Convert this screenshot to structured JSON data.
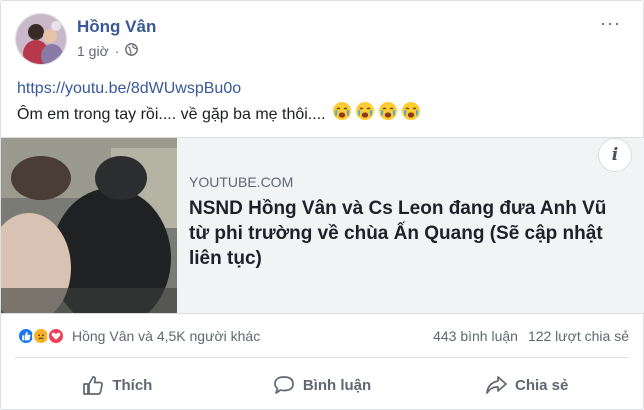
{
  "post": {
    "author": "Hồng Vân",
    "timestamp": "1 giờ",
    "privacy_icon": "globe-icon",
    "more_label": "···"
  },
  "content": {
    "link": "https://youtu.be/8dWUwspBu0o",
    "message": "Ôm em trong tay rồi.... về gặp ba mẹ thôi....",
    "emojis": [
      "crying-face",
      "crying-face",
      "crying-face",
      "crying-face"
    ]
  },
  "link_preview": {
    "domain": "YOUTUBE.COM",
    "title": "NSND Hồng Vân và Cs Leon đang đưa Anh Vũ từ phi trường về chùa Ấn Quang (Sẽ cập nhật liên tục)",
    "info_label": "i"
  },
  "stats": {
    "reaction_icons": [
      "like",
      "sad",
      "love"
    ],
    "reactors": "Hồng Vân và 4,5K người khác",
    "comments": "443 bình luận",
    "shares": "122 lượt chia sẻ"
  },
  "actions": {
    "like": "Thích",
    "comment": "Bình luận",
    "share": "Chia sẻ"
  },
  "colors": {
    "author": "#385898",
    "like_blue": "#1877f2",
    "love_red": "#f33e58",
    "sad_yellow": "#f7b125"
  }
}
